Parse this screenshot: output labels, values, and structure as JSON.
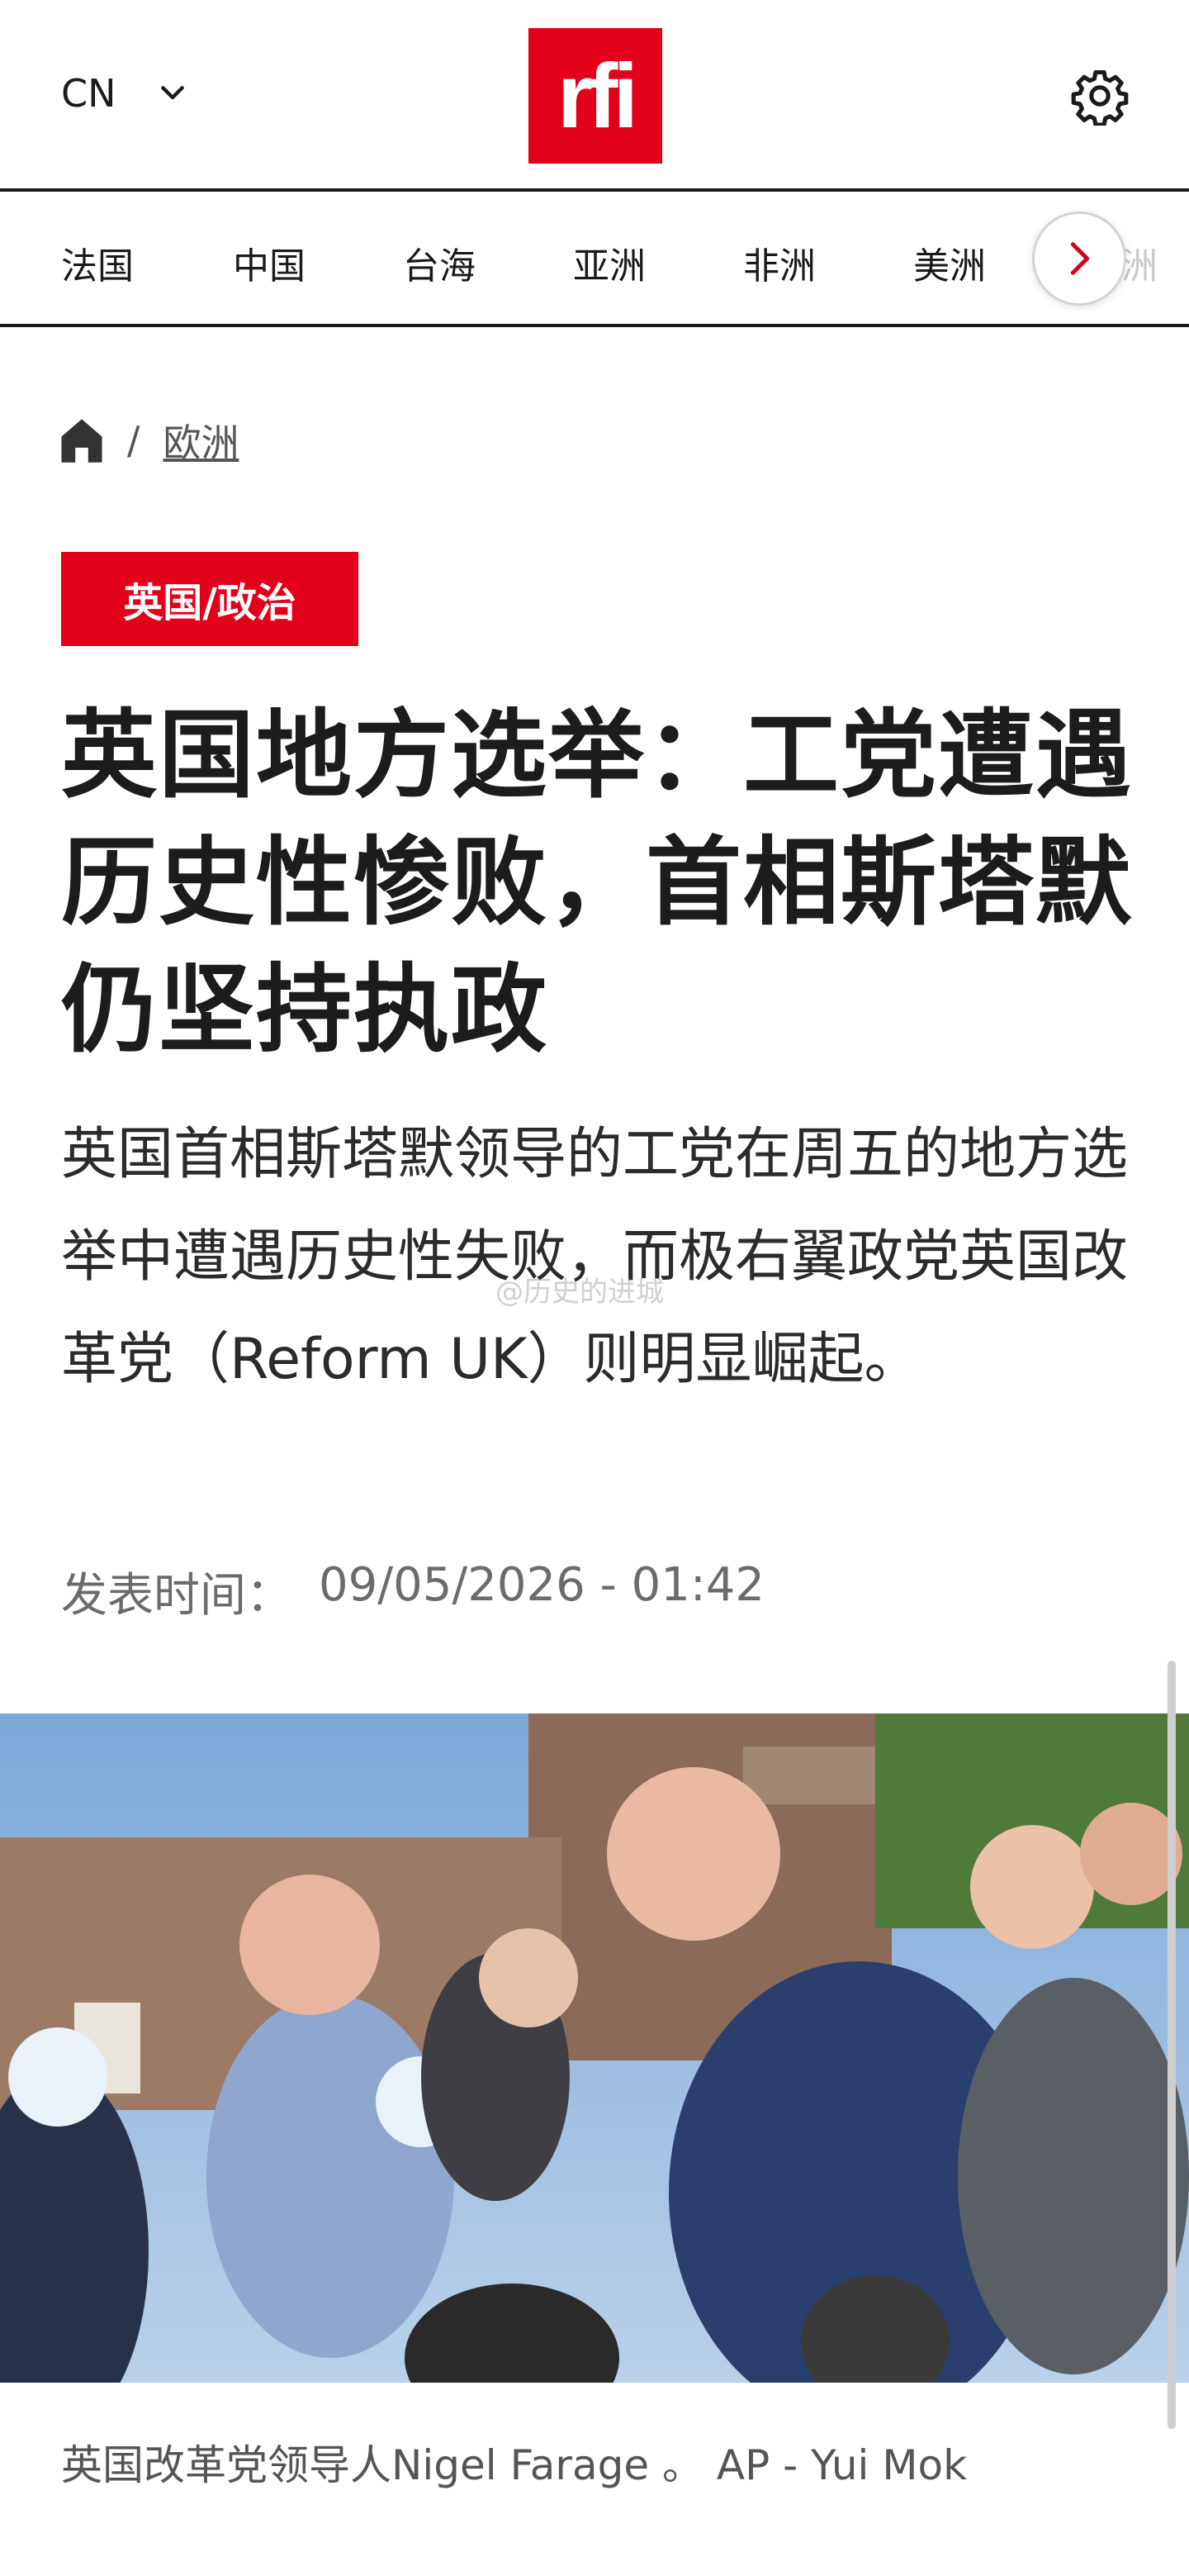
{
  "header": {
    "language": "CN",
    "logo_text": "rfi",
    "brand_color": "#e3001b"
  },
  "nav": {
    "items": [
      "法国",
      "中国",
      "台海",
      "亚洲",
      "非洲",
      "美洲",
      "欧洲"
    ]
  },
  "breadcrumb": {
    "home_icon": "home-icon",
    "separator": "/",
    "section": "欧洲"
  },
  "article": {
    "tag": "英国/政治",
    "title": "英国地方选举：工党遭遇历史性惨败，首相斯塔默仍坚持执政",
    "lead": "英国首相斯塔默领导的工党在周五的地方选举中遭遇历史性失败，而极右翼政党英国改革党（Reform UK）则明显崛起。",
    "watermark": "@历史的进城",
    "published_label": "发表时间：",
    "published_value": "09/05/2026 - 01:42",
    "photo_alt": "英国改革党领导人Nigel Farage 。 AP - Yui Mok",
    "caption": "英国改革党领导人Nigel Farage 。 AP - Yui Mok"
  }
}
